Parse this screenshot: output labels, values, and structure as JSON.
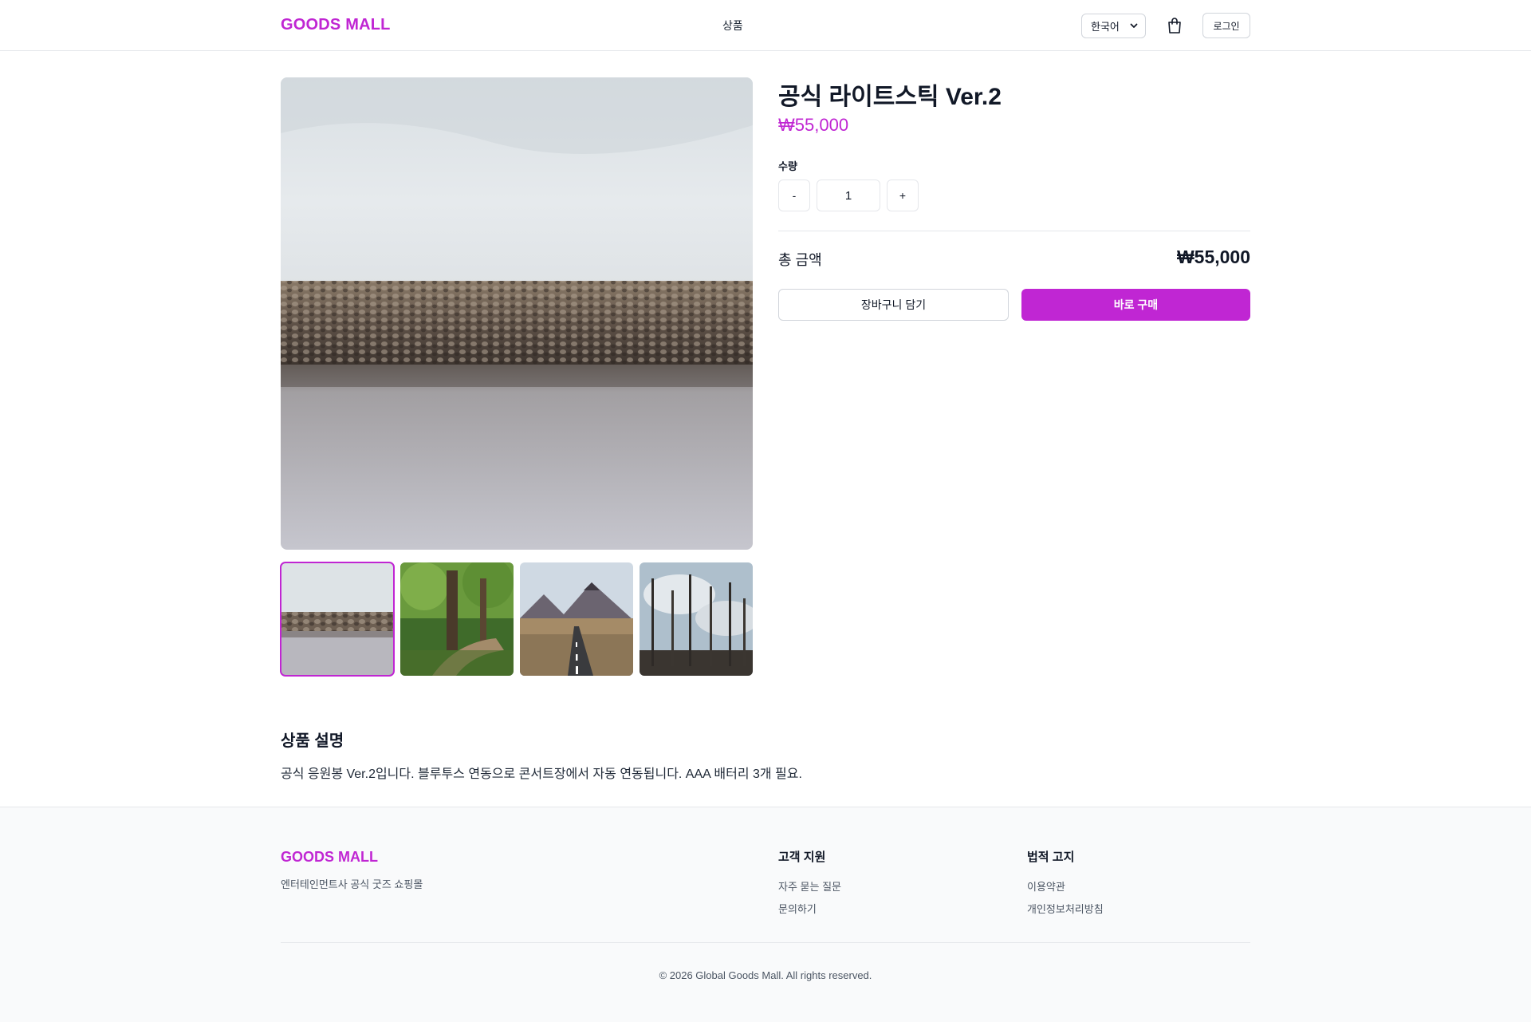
{
  "header": {
    "logo": "GOODS MALL",
    "nav_products": "상품",
    "language": "한국어",
    "login": "로그인"
  },
  "product": {
    "title": "공식 라이트스틱 Ver.2",
    "price": "₩55,000",
    "quantity_label": "수량",
    "quantity": "1",
    "decrement": "-",
    "increment": "+",
    "total_label": "총 금액",
    "total_value": "₩55,000",
    "add_to_cart": "장바구니 담기",
    "buy_now": "바로 구매"
  },
  "gallery": {
    "main_image": "lake-rock-barrier",
    "thumbnails": [
      "lake-rock-barrier",
      "forest-path",
      "mountain-road",
      "burnt-forest"
    ],
    "active_index": 0
  },
  "description": {
    "heading": "상품 설명",
    "text": "공식 응원봉 Ver.2입니다. 블루투스 연동으로 콘서트장에서 자동 연동됩니다. AAA 배터리 3개 필요."
  },
  "footer": {
    "logo": "GOODS MALL",
    "tagline": "엔터테인먼트사 공식 굿즈 쇼핑몰",
    "support_title": "고객 지원",
    "support_links": [
      "자주 묻는 질문",
      "문의하기"
    ],
    "legal_title": "법적 고지",
    "legal_links": [
      "이용약관",
      "개인정보처리방침"
    ],
    "copyright": "© 2026 Global Goods Mall. All rights reserved."
  },
  "colors": {
    "accent": "#c026d3",
    "border": "#e5e7eb",
    "footer_bg": "#f9fafb"
  },
  "icons": {
    "cart": "shopping-bag-icon",
    "language_dropdown": "chevron-down-icon"
  }
}
